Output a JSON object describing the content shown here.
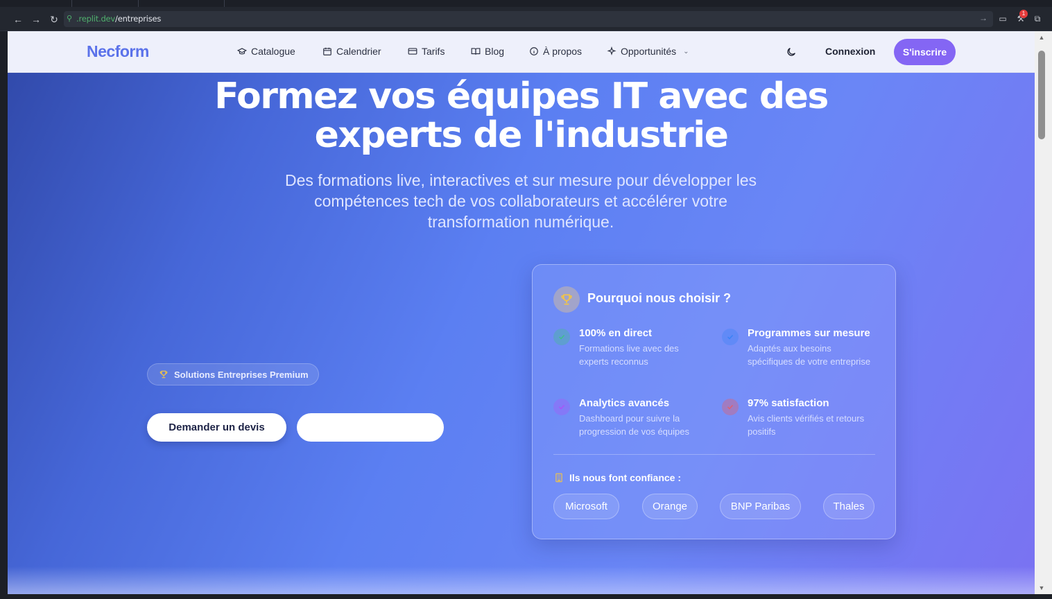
{
  "browser": {
    "url_host": ".replit.dev",
    "url_path": "/entreprises",
    "notification_count": "1"
  },
  "header": {
    "logo": "Necform",
    "nav": [
      {
        "label": "Catalogue",
        "icon": "graduation-cap-icon"
      },
      {
        "label": "Calendrier",
        "icon": "calendar-icon"
      },
      {
        "label": "Tarifs",
        "icon": "credit-card-icon"
      },
      {
        "label": "Blog",
        "icon": "book-open-icon"
      },
      {
        "label": "À propos",
        "icon": "info-icon"
      },
      {
        "label": "Opportunités",
        "icon": "sparkles-icon"
      }
    ],
    "login_label": "Connexion",
    "signup_label": "S'inscrire"
  },
  "hero": {
    "title_line1": "Formez vos équipes IT avec des",
    "title_line2": "experts de l'industrie",
    "subtitle": "Des formations live, interactives et sur mesure pour développer les compétences tech de vos collaborateurs et accélérer votre transformation numérique.",
    "badge": "Solutions Entreprises Premium",
    "cta_primary": "Demander un devis",
    "cta_secondary": ""
  },
  "card": {
    "title": "Pourquoi nous choisir ?",
    "features": [
      {
        "title": "100% en direct",
        "desc": "Formations live avec des experts reconnus",
        "color": "#3fc08a"
      },
      {
        "title": "Programmes sur mesure",
        "desc": "Adaptés aux besoins spécifiques de votre entreprise",
        "color": "#3b82f6"
      },
      {
        "title": "Analytics avancés",
        "desc": "Dashboard pour suivre la progression de vos équipes",
        "color": "#a855f7"
      },
      {
        "title": "97% satisfaction",
        "desc": "Avis clients vérifiés et retours positifs",
        "color": "#e0606e"
      }
    ],
    "trust_label": "Ils nous font confiance :",
    "companies": [
      "Microsoft",
      "Orange",
      "BNP Paribas",
      "Thales"
    ]
  },
  "colors": {
    "brand": "#5b72ea",
    "accent": "#8466f4",
    "trophy": "#f5c542"
  }
}
